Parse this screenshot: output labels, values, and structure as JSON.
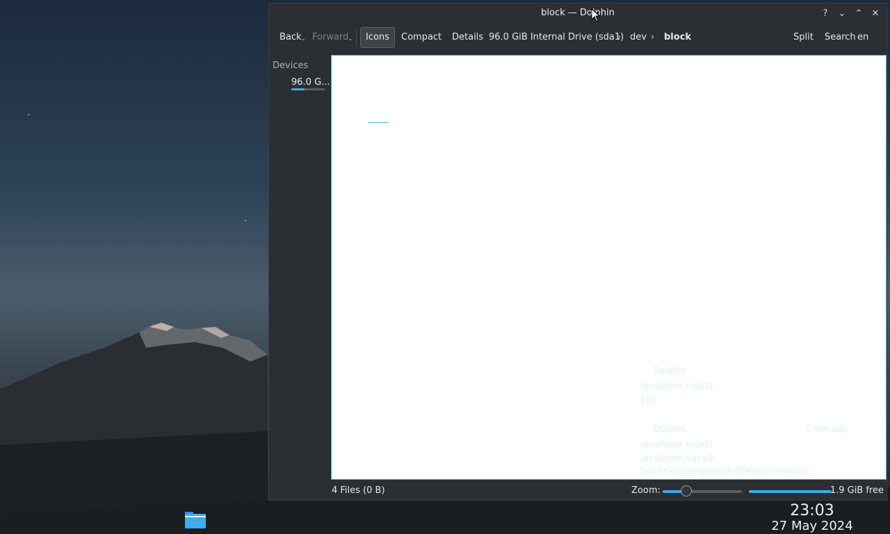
{
  "window": {
    "title": "block — Dolphin",
    "controls": [
      {
        "name": "help-icon",
        "glyph": "?"
      },
      {
        "name": "minimize-icon",
        "glyph": "⌄"
      },
      {
        "name": "maximize-icon",
        "glyph": "⌃"
      },
      {
        "name": "close-icon",
        "glyph": "✕"
      }
    ]
  },
  "toolbar": {
    "back": "Back",
    "forward": "Forward",
    "icons": "Icons",
    "compact": "Compact",
    "details": "Details",
    "split": "Split",
    "search": "Search",
    "menu": "en Me",
    "view_mode_active": "Icons"
  },
  "breadcrumb": {
    "items": [
      "96.0 GiB Internal Drive (sda1)",
      "dev",
      "block"
    ],
    "separator": "›"
  },
  "sidebar": {
    "heading": "Devices",
    "items": [
      {
        "label": "96.0 G..."
      }
    ]
  },
  "ghost_notifications": [
    {
      "app": "Dolphin",
      "line1": "/dev/block (sda1)",
      "line2": "Exit"
    },
    {
      "app": "Dolphin",
      "time": "1 min ago",
      "line1": "/dev/block (sda1)",
      "line2": "/dev/block/vdev/b",
      "line3": "Sub/link/c/d/efgh/path/SDK/xyz/mnt/ab/c"
    }
  ],
  "statusbar": {
    "files": "4 Files (0 B)",
    "zoom_label": "Zoom:",
    "zoom_fraction": 0.3,
    "free": "1.9 GiB free",
    "used_fraction": 0.98
  },
  "taskbar": {
    "time": "23:03",
    "date": "27 May 2024"
  },
  "colors": {
    "accent": "#3daee9",
    "window_bg": "#2b2f33"
  }
}
